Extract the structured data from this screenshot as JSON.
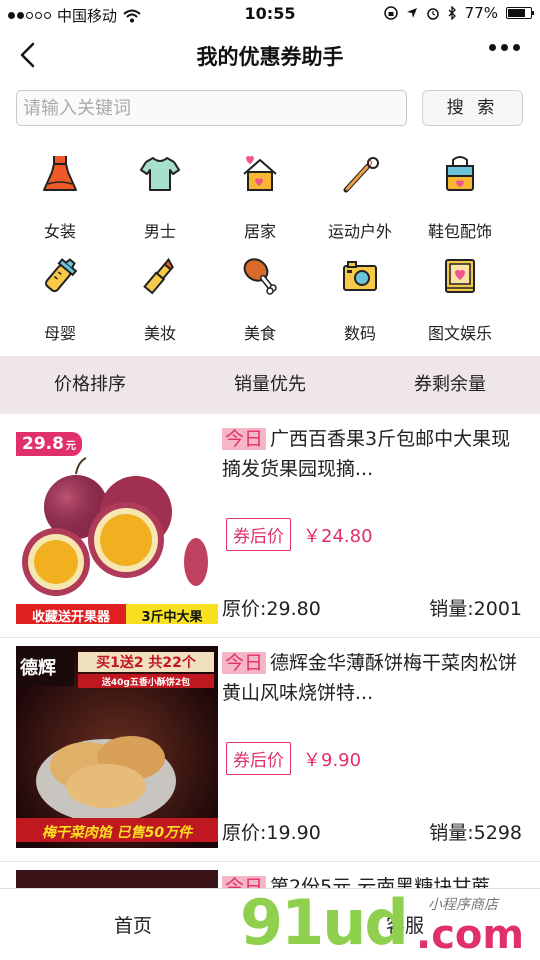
{
  "status": {
    "carrier": "中国移动",
    "time": "10:55",
    "battery": "77%",
    "battery_level": 0.77
  },
  "nav": {
    "title": "我的优惠券助手"
  },
  "search": {
    "placeholder": "请输入关键词",
    "button": "搜 索"
  },
  "categories": [
    {
      "label": "女装",
      "icon": "dress-icon"
    },
    {
      "label": "男士",
      "icon": "tshirt-icon"
    },
    {
      "label": "居家",
      "icon": "house-icon"
    },
    {
      "label": "运动户外",
      "icon": "baseball-icon"
    },
    {
      "label": "鞋包配饰",
      "icon": "bag-icon"
    },
    {
      "label": "母婴",
      "icon": "baby-bottle-icon"
    },
    {
      "label": "美妆",
      "icon": "lipstick-icon"
    },
    {
      "label": "美食",
      "icon": "drumstick-icon"
    },
    {
      "label": "数码",
      "icon": "camera-icon"
    },
    {
      "label": "图文娱乐",
      "icon": "book-icon"
    }
  ],
  "sort": [
    "价格排序",
    "销量优先",
    "券剩余量"
  ],
  "products": [
    {
      "today": "今日",
      "name": "广西百香果3斤包邮中大果现摘发货果园现摘...",
      "coupon_tag": "券后价",
      "coupon_price": "￥24.80",
      "original": "原价:29.80",
      "sales": "销量:2001",
      "image_badge": "29.8",
      "image_badge_unit": "元",
      "image_banner_left": "收藏送开果器",
      "image_banner_right": "3斤中大果"
    },
    {
      "today": "今日",
      "name": "德辉金华薄酥饼梅干菜肉松饼黄山风味烧饼特...",
      "coupon_tag": "券后价",
      "coupon_price": "￥9.90",
      "original": "原价:19.90",
      "sales": "销量:5298",
      "image_brand": "德辉",
      "image_promo_1": "买1送2 共22个",
      "image_promo_2": "送40g五香小酥饼2包",
      "image_banner": "梅干菜肉馅 已售50万件"
    },
    {
      "today": "今日",
      "name": "第2份5元 云南黑糖块甘蔗"
    }
  ],
  "tabbar": {
    "home": "首页",
    "service": "客服"
  },
  "watermark": {
    "text": "91ud",
    "dotcom": ".com",
    "cn": "小程序商店"
  },
  "colors": {
    "accent": "#e0306a",
    "today_bg": "#f6b6c6",
    "sort_bg": "#efe6e7",
    "watermark_green": "#8fd14f"
  }
}
